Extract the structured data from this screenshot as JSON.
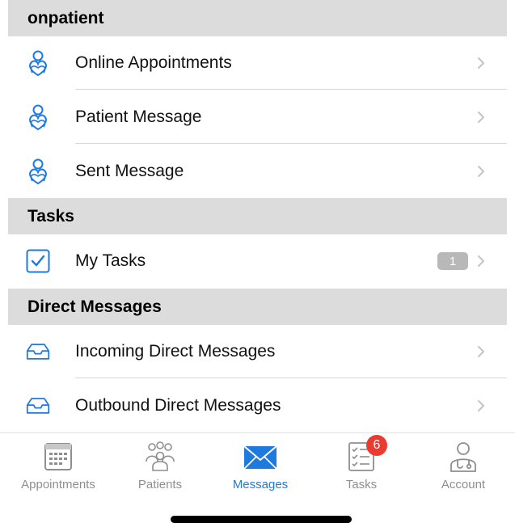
{
  "sections": {
    "onpatient": {
      "title": "onpatient",
      "items": [
        {
          "label": "Online Appointments",
          "icon": "onpatient-heart-person-icon"
        },
        {
          "label": "Patient Message",
          "icon": "onpatient-heart-person-icon"
        },
        {
          "label": "Sent Message",
          "icon": "onpatient-heart-person-icon"
        }
      ]
    },
    "tasks": {
      "title": "Tasks",
      "items": [
        {
          "label": "My Tasks",
          "icon": "checkbox-icon",
          "count": "1"
        }
      ]
    },
    "direct_messages": {
      "title": "Direct Messages",
      "items": [
        {
          "label": "Incoming Direct Messages",
          "icon": "inbox-tray-icon"
        },
        {
          "label": "Outbound Direct Messages",
          "icon": "inbox-tray-icon"
        }
      ]
    }
  },
  "tabbar": {
    "tabs": [
      {
        "label": "Appointments",
        "icon": "calendar-icon",
        "active": false
      },
      {
        "label": "Patients",
        "icon": "people-icon",
        "active": false
      },
      {
        "label": "Messages",
        "icon": "envelope-icon",
        "active": true
      },
      {
        "label": "Tasks",
        "icon": "checklist-icon",
        "active": false,
        "badge": "6"
      },
      {
        "label": "Account",
        "icon": "doctor-icon",
        "active": false
      }
    ]
  },
  "colors": {
    "accent": "#1f7ae0",
    "section_bg": "#dcdcdc",
    "badge_red": "#ea3b32",
    "inactive": "#8e8e8e"
  }
}
